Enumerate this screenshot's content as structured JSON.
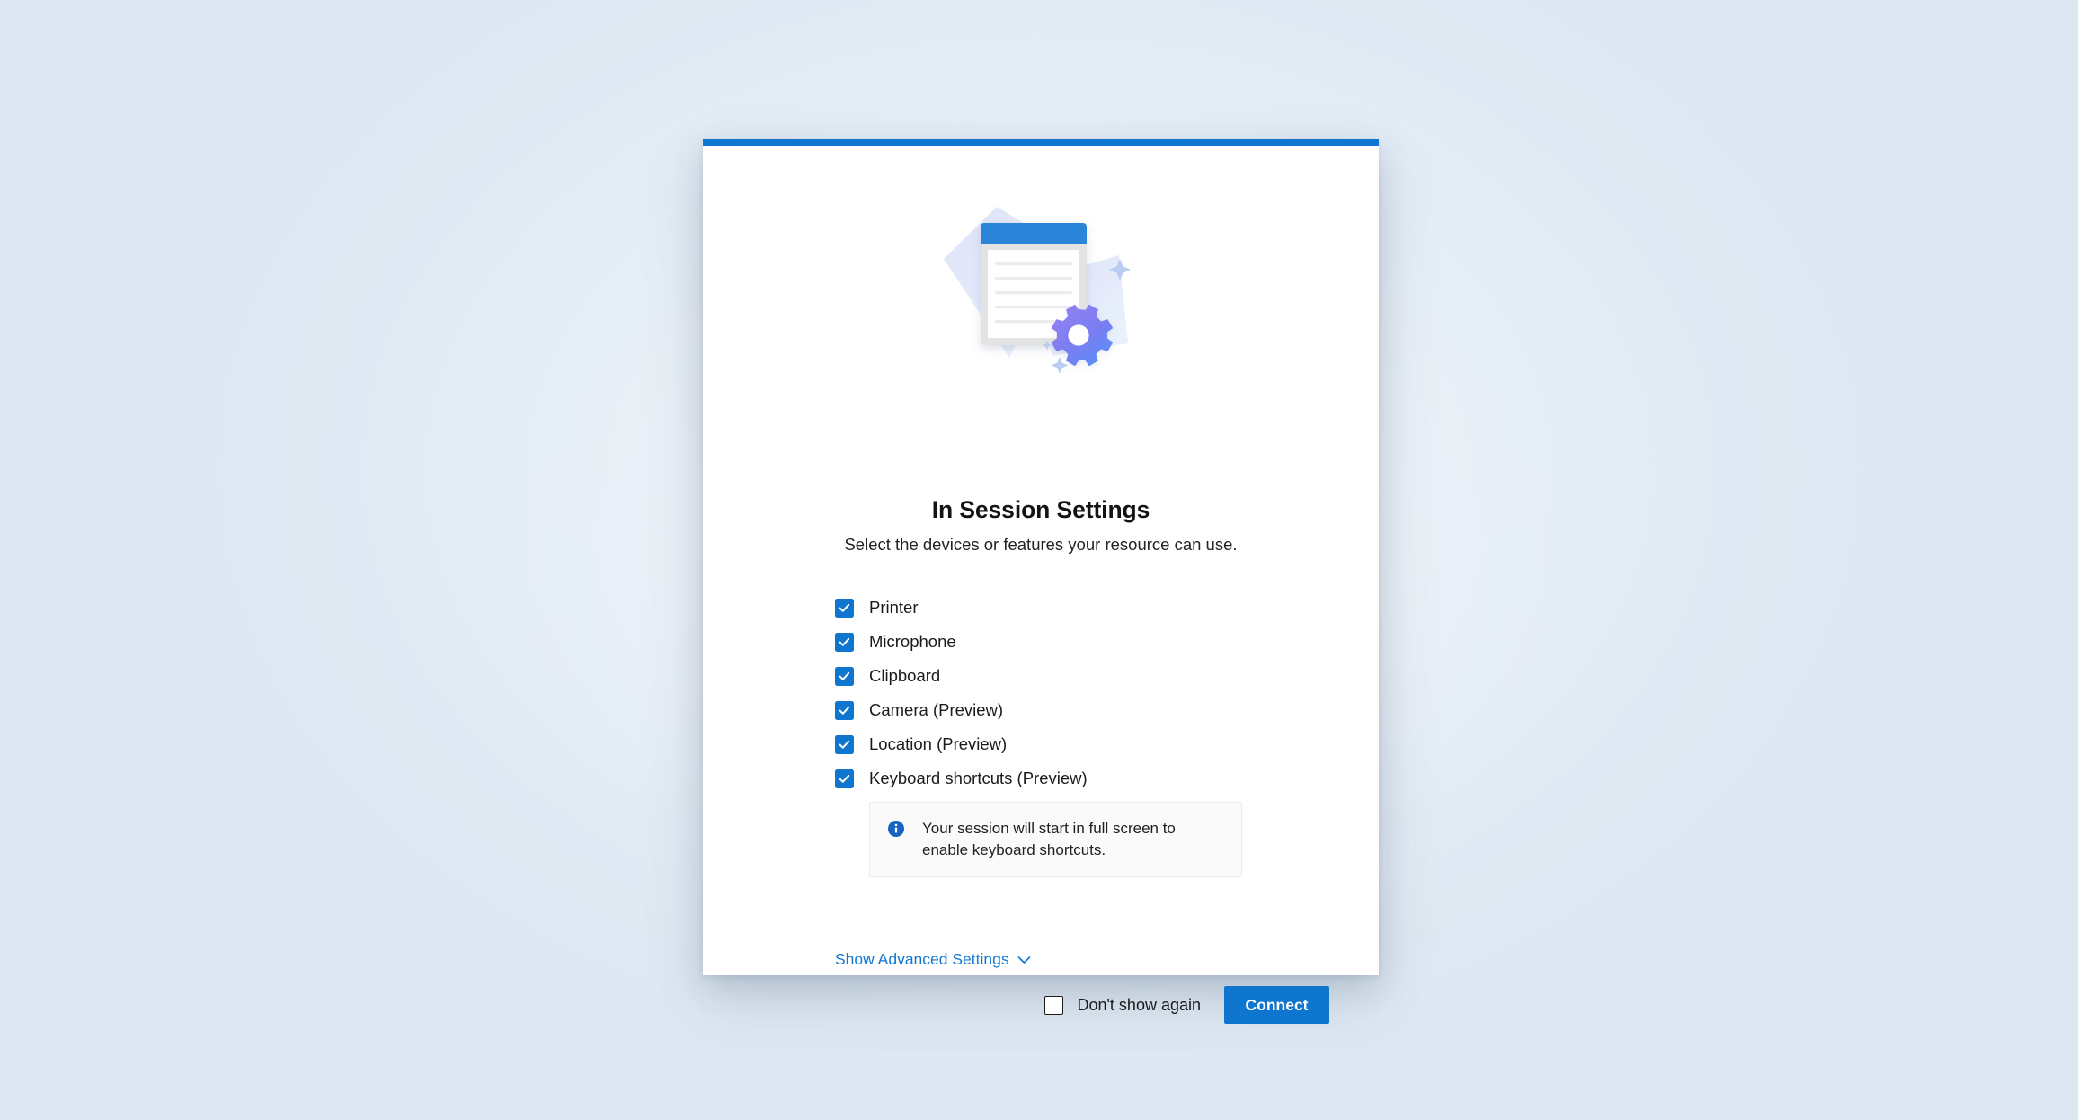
{
  "dialog": {
    "title": "In Session Settings",
    "subtitle": "Select the devices or features your resource can use.",
    "accent_color": "#0f76d0"
  },
  "illustration": {
    "name": "document-with-gear-illustration",
    "document_titlebar_color": "#2a84d8",
    "gear_gradient_from": "#8d7cf0",
    "gear_gradient_to": "#5b8ef5",
    "card_color": "#dfe4f8"
  },
  "options": [
    {
      "label": "Printer",
      "checked": true,
      "name": "printer"
    },
    {
      "label": "Microphone",
      "checked": true,
      "name": "microphone"
    },
    {
      "label": "Clipboard",
      "checked": true,
      "name": "clipboard"
    },
    {
      "label": "Camera (Preview)",
      "checked": true,
      "name": "camera"
    },
    {
      "label": "Location (Preview)",
      "checked": true,
      "name": "location"
    },
    {
      "label": "Keyboard shortcuts (Preview)",
      "checked": true,
      "name": "keyboard-shortcuts"
    }
  ],
  "info_banner": {
    "icon": "info-circle-icon",
    "text": "Your session will start in full screen to enable keyboard shortcuts."
  },
  "advanced_settings": {
    "label": "Show Advanced Settings",
    "chevron": "chevron-down-icon",
    "link_color": "#1278d4"
  },
  "footer": {
    "dont_show_again_label": "Don't show again",
    "dont_show_again_checked": false,
    "connect_label": "Connect"
  }
}
